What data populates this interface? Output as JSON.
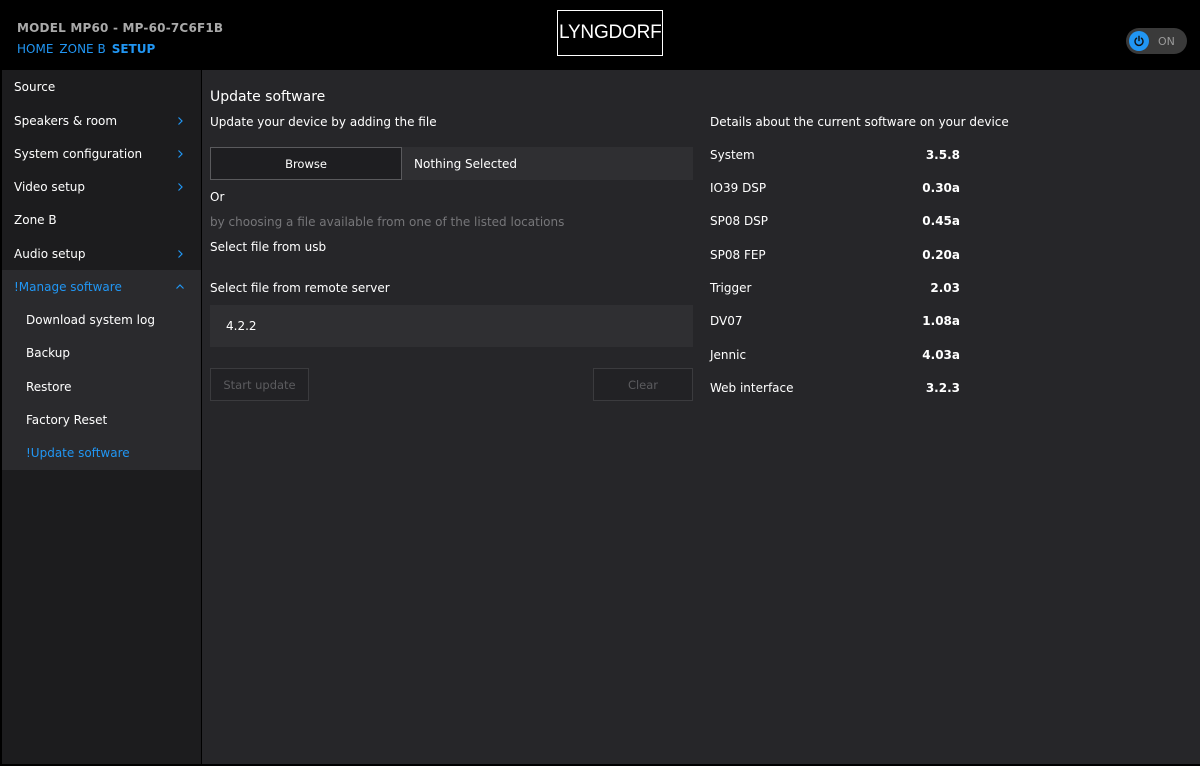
{
  "header": {
    "model": "MODEL MP60 - MP-60-7C6F1B",
    "nav": [
      "HOME",
      "ZONE B",
      "SETUP"
    ],
    "logo_left": "LYNG",
    "logo_right": "DORF",
    "power_label": "ON",
    "accent_color": "#2196f3"
  },
  "sidebar": {
    "items": [
      {
        "label": "Source"
      },
      {
        "label": "Speakers & room"
      },
      {
        "label": "System configuration"
      },
      {
        "label": "Video setup"
      },
      {
        "label": "Zone B"
      },
      {
        "label": "Audio setup"
      },
      {
        "label": "!Manage software"
      }
    ],
    "subitems": [
      {
        "label": "Download system log"
      },
      {
        "label": "Backup"
      },
      {
        "label": "Restore"
      },
      {
        "label": "Factory Reset"
      },
      {
        "label": "!Update software"
      }
    ]
  },
  "main": {
    "title": "Update software",
    "add_file_label": "Update your device by adding the file",
    "browse_label": "Browse",
    "file_status": "Nothing Selected",
    "or_label": "Or",
    "choose_hint": "by choosing a file available from one of the listed locations",
    "usb_label": "Select file from usb",
    "remote_label": "Select file from remote server",
    "remote_value": "4.2.2",
    "start_update_label": "Start update",
    "clear_label": "Clear"
  },
  "details": {
    "heading": "Details about the current software on your device",
    "rows": [
      {
        "name": "System",
        "value": "3.5.8"
      },
      {
        "name": "IO39 DSP",
        "value": "0.30a"
      },
      {
        "name": "SP08 DSP",
        "value": "0.45a"
      },
      {
        "name": "SP08 FEP",
        "value": "0.20a"
      },
      {
        "name": "Trigger",
        "value": "2.03"
      },
      {
        "name": "DV07",
        "value": "1.08a"
      },
      {
        "name": "Jennic",
        "value": "4.03a"
      },
      {
        "name": "Web interface",
        "value": "3.2.3"
      }
    ]
  }
}
